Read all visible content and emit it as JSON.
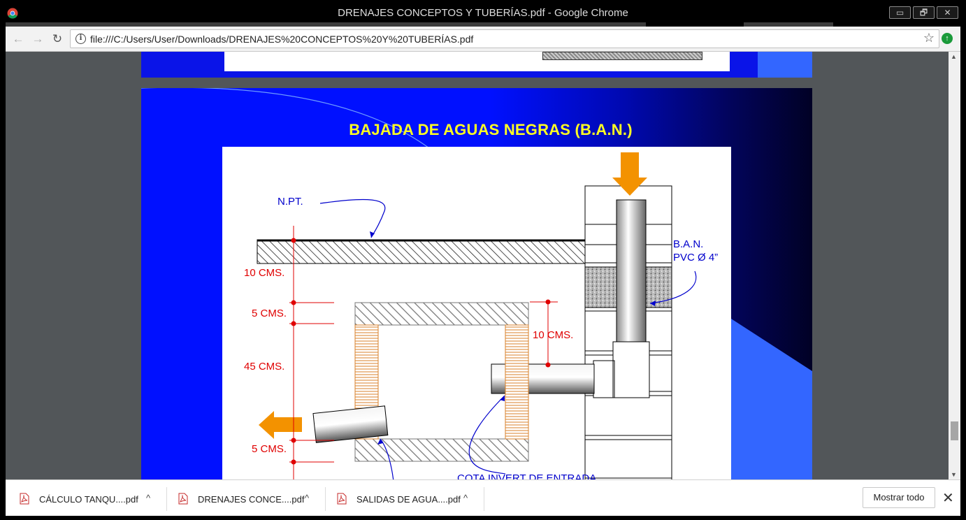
{
  "window": {
    "title": "DRENAJES CONCEPTOS Y TUBERÍAS.pdf - Google Chrome",
    "minimize_glyph": "▭",
    "maximize_glyph": "🗗",
    "close_glyph": "✕"
  },
  "toolbar": {
    "url": "file:///C:/Users/User/Downloads/DRENAJES%20CONCEPTOS%20Y%20TUBERÍAS.pdf",
    "back_glyph": "←",
    "forward_glyph": "→",
    "reload_glyph": "↻",
    "info_glyph": "i",
    "star_glyph": "☆",
    "extension_glyph": "↑"
  },
  "slide": {
    "title": "BAJADA DE AGUAS NEGRAS (B.A.N.)",
    "labels": {
      "npt": "N.PT.",
      "ban_line1": "B.A.N.",
      "ban_line2": "PVC Ø 4”",
      "dim_10_top": "10 CMS.",
      "dim_5_top": "5 CMS.",
      "dim_45": "45 CMS.",
      "dim_5_bottom": "5 CMS.",
      "dim_10_right": "10 CMS.",
      "cota": "COTA INVERT DE ENTRADA"
    },
    "colors": {
      "slide_blue": "#0010ff",
      "title_yellow": "#ffff22",
      "dimension_red": "#e00000",
      "annotation_blue": "#0000cc",
      "arrow_orange": "#f39200",
      "brick_orange": "#d9822b",
      "accent_blue": "#3366ff"
    }
  },
  "downloads": {
    "items": [
      {
        "name": "CÁLCULO TANQU....pdf"
      },
      {
        "name": "DRENAJES CONCE....pdf"
      },
      {
        "name": "SALIDAS DE AGUA....pdf"
      }
    ],
    "chevron_glyph": "^",
    "show_all": "Mostrar todo",
    "close_glyph": "✕"
  }
}
